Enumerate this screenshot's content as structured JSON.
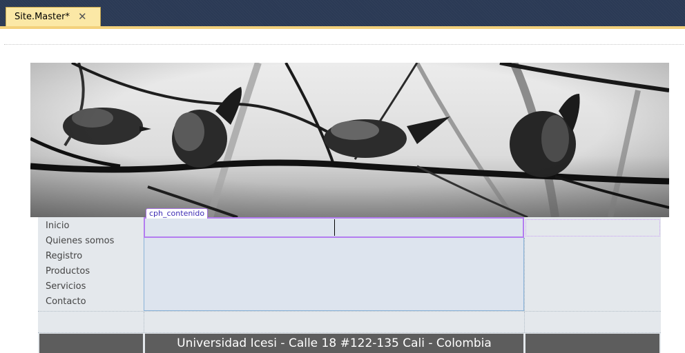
{
  "editor": {
    "tab_label": "Site.Master*",
    "close_icon": "close-icon"
  },
  "designer": {
    "content_placeholder_label": "cph_contenido",
    "banner_image": "birds-on-branches-banner"
  },
  "nav": {
    "items": [
      {
        "label": "Inicio"
      },
      {
        "label": "Quienes somos"
      },
      {
        "label": "Registro"
      },
      {
        "label": "Productos"
      },
      {
        "label": "Servicios"
      },
      {
        "label": "Contacto"
      }
    ]
  },
  "footer": {
    "text": "Universidad Icesi - Calle 18 #122-135 Cali - Colombia"
  },
  "colors": {
    "titlebar": "#2b3a55",
    "tab_active": "#fbe8a6",
    "placeholder_border": "#b37cf0",
    "footer_bg": "#5d5d5d"
  }
}
